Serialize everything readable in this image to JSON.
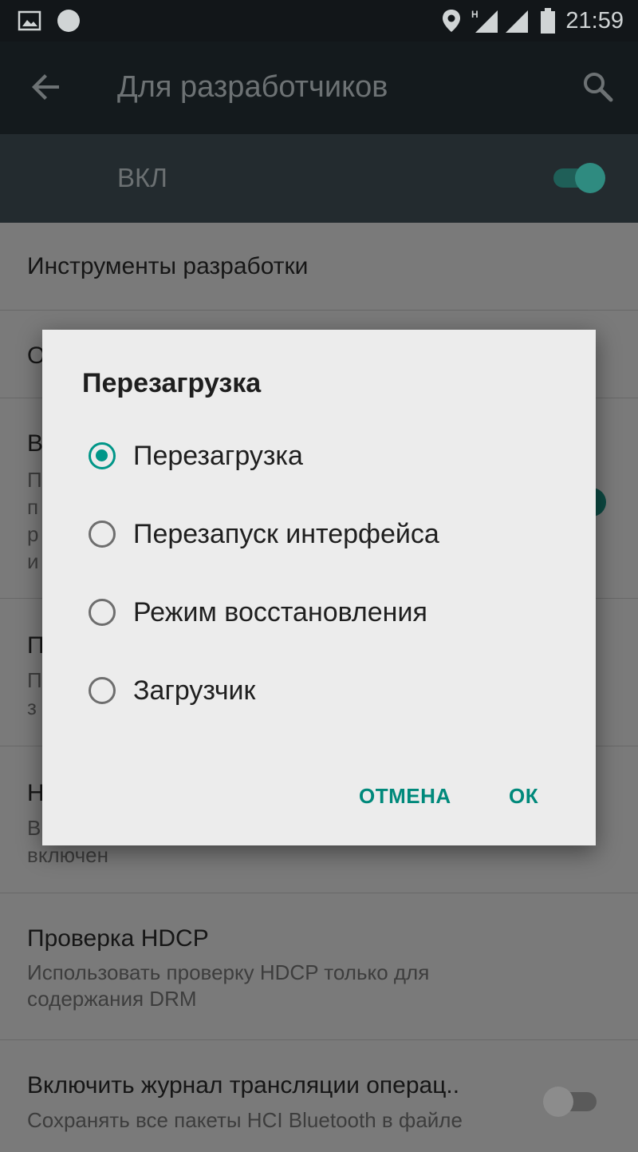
{
  "status_bar": {
    "time": "21:59",
    "icons": [
      "image-icon",
      "circle-notification-icon",
      "location-icon",
      "signal-h-icon",
      "signal-icon",
      "battery-icon"
    ],
    "network_type": "H"
  },
  "toolbar": {
    "title": "Для разработчиков",
    "back_icon": "arrow-back-icon",
    "search_icon": "search-icon"
  },
  "master_switch": {
    "label": "ВКЛ",
    "on": true
  },
  "settings_list": [
    {
      "title": "Инструменты разработки"
    },
    {
      "title": "О"
    },
    {
      "title": "В",
      "subtitle_lines": [
        "П",
        "п",
        "р",
        "и"
      ],
      "toggle_on": true
    },
    {
      "title": "П",
      "subtitle_lines": [
        "П",
        "з"
      ]
    },
    {
      "title": "Н",
      "subtitle_lines": [
        "В",
        "включен"
      ]
    },
    {
      "title": "Проверка HDCP",
      "subtitle_lines": [
        "Использовать проверку HDCP только для",
        "содержания DRM"
      ]
    },
    {
      "title": "Включить журнал трансляции операц..",
      "subtitle_lines": [
        "Сохранять все пакеты HCI Bluetooth в файле"
      ],
      "toggle_on": false
    }
  ],
  "dialog": {
    "title": "Перезагрузка",
    "options": [
      {
        "label": "Перезагрузка",
        "selected": true
      },
      {
        "label": "Перезапуск интерфейса",
        "selected": false
      },
      {
        "label": "Режим восстановления",
        "selected": false
      },
      {
        "label": "Загрузчик",
        "selected": false
      }
    ],
    "cancel_label": "ОТМЕНА",
    "ok_label": "ОК"
  },
  "colors": {
    "accent": "#009688",
    "dialog_background": "#ececec",
    "toolbar": "#141a1d",
    "dim_overlay": "#7a7a7a"
  }
}
